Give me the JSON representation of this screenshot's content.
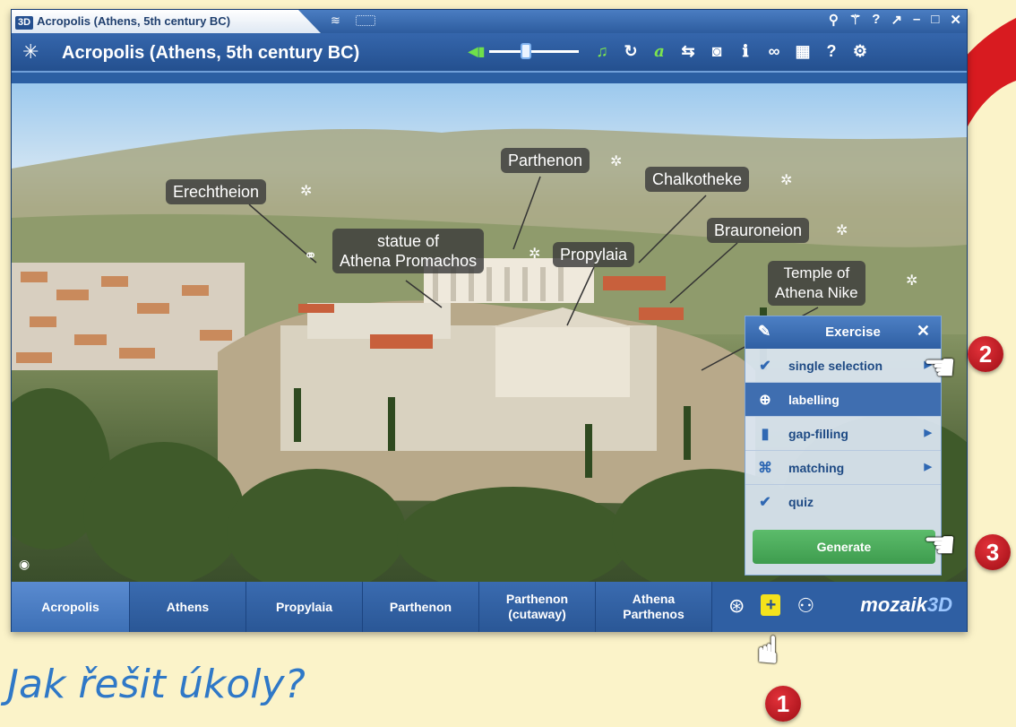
{
  "window": {
    "title_logo": "3D",
    "title": "Acropolis (Athens, 5th century BC)",
    "title_controls": [
      "share-icon",
      "pin-icon",
      "help-icon",
      "restore-icon",
      "minimize-icon",
      "maximize-icon",
      "close-icon"
    ],
    "title_control_glyphs": [
      "⚲",
      "⚚",
      "?",
      "↗",
      "–",
      "□",
      "✕"
    ]
  },
  "toolbar": {
    "app_title": "Acropolis (Athens, 5th century BC)",
    "volume_level": 0.4,
    "icons": [
      "music-icon",
      "reset-icon",
      "text-icon",
      "split-view-icon",
      "camera-icon",
      "info-icon",
      "link-icon",
      "grid-icon",
      "help-icon",
      "settings-icon"
    ]
  },
  "scene": {
    "labels": [
      {
        "id": "erechtheion",
        "text": "Erechtheion"
      },
      {
        "id": "parthenon",
        "text": "Parthenon"
      },
      {
        "id": "chalkotheke",
        "text": "Chalkotheke"
      },
      {
        "id": "brauroneion",
        "text": "Brauroneion"
      },
      {
        "id": "athena-promachos",
        "text": "statue of\nAthena Promachos"
      },
      {
        "id": "propylaia",
        "text": "Propylaia"
      },
      {
        "id": "athena-nike",
        "text": "Temple of\nAthena Nike"
      }
    ]
  },
  "exercise": {
    "title": "Exercise",
    "items": [
      {
        "label": "single selection",
        "icon": "check-icon",
        "has_submenu": true
      },
      {
        "label": "labelling",
        "icon": "crosshair-icon",
        "has_submenu": false
      },
      {
        "label": "gap-filling",
        "icon": "text-box-icon",
        "has_submenu": true
      },
      {
        "label": "matching",
        "icon": "matching-icon",
        "has_submenu": true
      },
      {
        "label": "quiz",
        "icon": "check-icon",
        "has_submenu": false
      }
    ],
    "active_item": "labelling",
    "generate_label": "Generate"
  },
  "bottom_nav": {
    "tabs": [
      {
        "label": "Acropolis"
      },
      {
        "label": "Athens"
      },
      {
        "label": "Propylaia"
      },
      {
        "label": "Parthenon"
      },
      {
        "label": "Parthenon\n(cutaway)"
      },
      {
        "label": "Athena\nParthenos"
      }
    ],
    "active_tab": "Acropolis",
    "brand_main": "mozaik",
    "brand_suffix": "3D"
  },
  "annotations": {
    "steps": [
      "1",
      "2",
      "3"
    ],
    "caption": "Jak řešit úkoly?"
  },
  "colors": {
    "page_background": "#fbf3c9",
    "window_blue": "#2b5fa3",
    "step_badge_red": "#c61a22",
    "generate_green": "#4caf5c",
    "caption_blue": "#2f78c7"
  }
}
